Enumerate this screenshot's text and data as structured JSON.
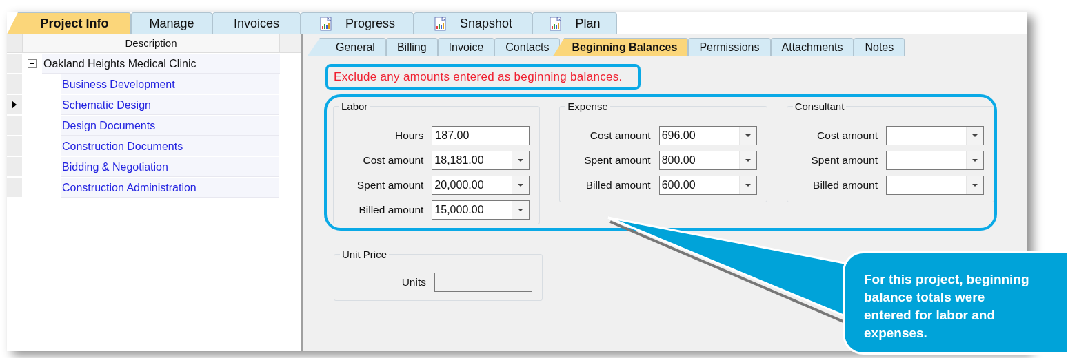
{
  "main_tabs": [
    {
      "label": "Project Info",
      "selected": true,
      "kind": "plain"
    },
    {
      "label": "Manage",
      "selected": false,
      "kind": "plain"
    },
    {
      "label": "Invoices",
      "selected": false,
      "kind": "plain"
    },
    {
      "label": "Progress",
      "selected": false,
      "kind": "report"
    },
    {
      "label": "Snapshot",
      "selected": false,
      "kind": "report"
    },
    {
      "label": "Plan",
      "selected": false,
      "kind": "report"
    }
  ],
  "tree": {
    "header": "Description",
    "rows": [
      {
        "label": "Oakland Heights Medical Clinic",
        "expanded": true,
        "selected": false,
        "children": [
          {
            "label": "Business Development",
            "selected": false
          },
          {
            "label": "Schematic Design",
            "selected": true
          },
          {
            "label": "Design Documents",
            "selected": false
          },
          {
            "label": "Construction Documents",
            "selected": false
          },
          {
            "label": "Bidding & Negotiation",
            "selected": false
          },
          {
            "label": "Construction Administration",
            "selected": false
          }
        ]
      }
    ]
  },
  "sub_tabs": [
    {
      "label": "General",
      "selected": false
    },
    {
      "label": "Billing",
      "selected": false
    },
    {
      "label": "Invoice",
      "selected": false
    },
    {
      "label": "Contacts",
      "selected": false
    },
    {
      "label": "Beginning Balances",
      "selected": true
    },
    {
      "label": "Permissions",
      "selected": false
    },
    {
      "label": "Attachments",
      "selected": false
    },
    {
      "label": "Notes",
      "selected": false
    }
  ],
  "note": "Exclude any amounts entered as beginning balances.",
  "groups": [
    {
      "title": "Labor",
      "fields": [
        {
          "label": "Hours",
          "value": "187.00",
          "kind": "text"
        },
        {
          "label": "Cost amount",
          "value": "18,181.00",
          "kind": "dropdown"
        },
        {
          "label": "Spent amount",
          "value": "20,000.00",
          "kind": "dropdown"
        },
        {
          "label": "Billed amount",
          "value": "15,000.00",
          "kind": "dropdown"
        }
      ]
    },
    {
      "title": "Expense",
      "fields": [
        {
          "label": "Cost amount",
          "value": "696.00",
          "kind": "dropdown"
        },
        {
          "label": "Spent amount",
          "value": "800.00",
          "kind": "dropdown"
        },
        {
          "label": "Billed amount",
          "value": "600.00",
          "kind": "dropdown"
        }
      ]
    },
    {
      "title": "Consultant",
      "fields": [
        {
          "label": "Cost amount",
          "kind": "dropdown"
        },
        {
          "label": "Spent amount",
          "kind": "dropdown"
        },
        {
          "label": "Billed amount",
          "kind": "dropdown"
        }
      ]
    }
  ],
  "unit_price": {
    "title": "Unit Price",
    "fields": [
      {
        "label": "Units",
        "kind": "text",
        "disabled": true
      }
    ]
  },
  "callout": "For this project, beginning balance totals were entered for labor and expenses."
}
